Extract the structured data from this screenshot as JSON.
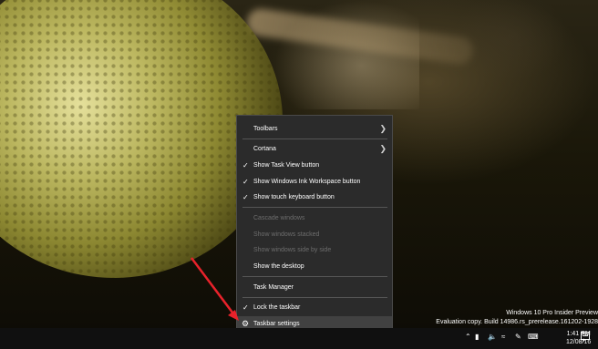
{
  "context_menu": {
    "items": [
      {
        "label": "Toolbars",
        "checked": false,
        "disabled": false,
        "submenu": true
      },
      {
        "label": "Cortana",
        "checked": false,
        "disabled": false,
        "submenu": true
      },
      {
        "label": "Show Task View button",
        "checked": true,
        "disabled": false
      },
      {
        "label": "Show Windows Ink Workspace button",
        "checked": true,
        "disabled": false
      },
      {
        "label": "Show touch keyboard button",
        "checked": true,
        "disabled": false
      },
      {
        "label": "Cascade windows",
        "checked": false,
        "disabled": true
      },
      {
        "label": "Show windows stacked",
        "checked": false,
        "disabled": true
      },
      {
        "label": "Show windows side by side",
        "checked": false,
        "disabled": true
      },
      {
        "label": "Show the desktop",
        "checked": false,
        "disabled": false
      },
      {
        "label": "Task Manager",
        "checked": false,
        "disabled": false
      },
      {
        "label": "Lock the taskbar",
        "checked": true,
        "disabled": false
      },
      {
        "label": "Taskbar settings",
        "checked": false,
        "disabled": false,
        "icon": "gear-icon",
        "highlighted": true
      }
    ]
  },
  "watermark": {
    "line1": "Windows 10 Pro Insider Preview",
    "line2": "Evaluation copy. Build 14986.rs_prerelease.161202-1928"
  },
  "taskbar": {
    "tray_icons": [
      "chevron-up-icon",
      "tablet-icon",
      "speaker-icon",
      "wifi-icon",
      "pen-icon",
      "keyboard-icon"
    ],
    "clock": {
      "time": "1:41 PM",
      "date": "12/08/16"
    },
    "notification_icon": "action-center-icon"
  },
  "annotation": {
    "arrow_color": "#e8222b"
  },
  "colors": {
    "menu_bg": "#2b2b2b",
    "menu_highlight": "#414141",
    "disabled_text": "#6d6d6d"
  }
}
